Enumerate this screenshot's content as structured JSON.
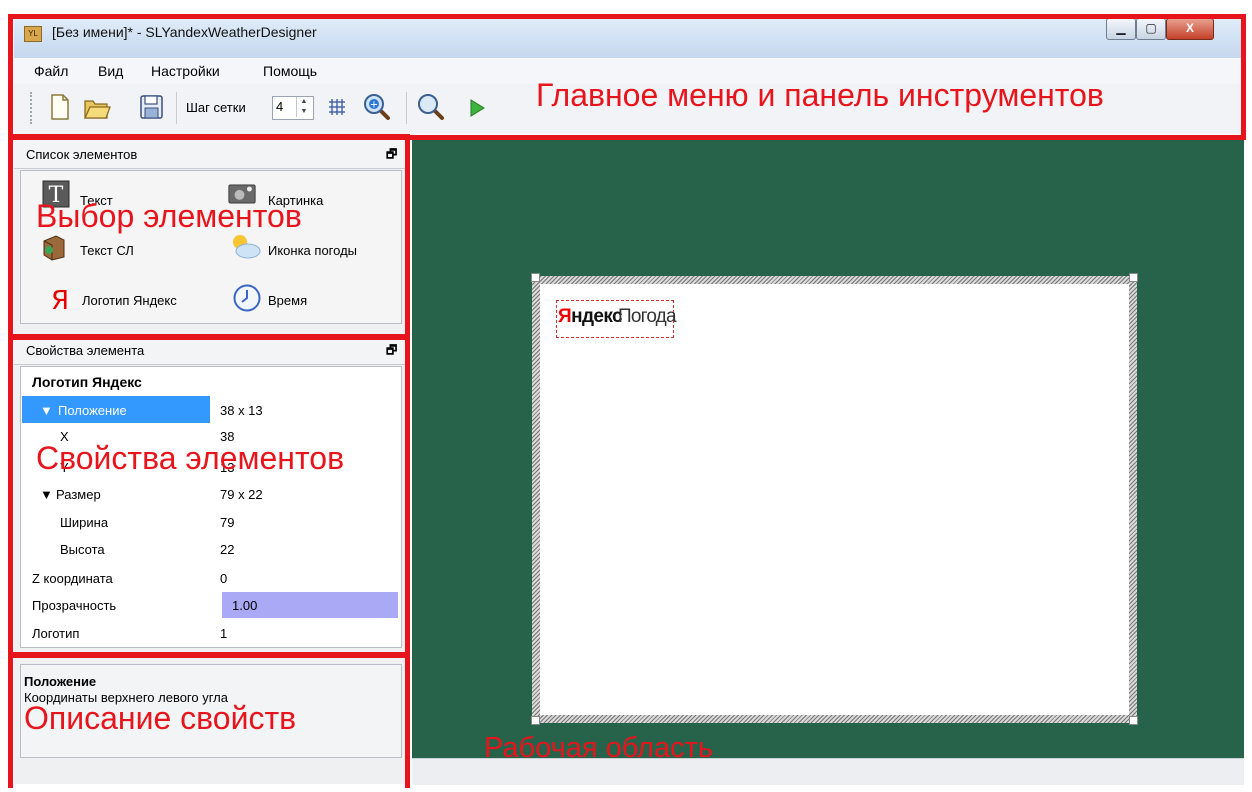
{
  "window": {
    "title": "[Без имени]* - SLYandexWeatherDesigner",
    "app_icon_text": "YL",
    "controls": {
      "minimize": "▁",
      "maximize": "▢",
      "close": "X"
    }
  },
  "menu": {
    "items": [
      "Файл",
      "Вид",
      "Настройки",
      "Помощь"
    ]
  },
  "toolbar": {
    "grid_step_label": "Шаг сетки",
    "grid_step_value": "4",
    "icons": [
      "new-file-icon",
      "open-folder-icon",
      "save-icon",
      "grid-icon",
      "zoom-in-icon",
      "zoom-out-icon",
      "play-icon"
    ]
  },
  "elements_panel": {
    "title": "Список элементов",
    "float_icon": "🗗",
    "items": [
      {
        "label": "Текст",
        "icon": "text-icon"
      },
      {
        "label": "Картинка",
        "icon": "picture-icon"
      },
      {
        "label": "Текст СЛ",
        "icon": "text-sl-icon"
      },
      {
        "label": "Иконка погоды",
        "icon": "weather-icon"
      },
      {
        "label": "Логотип Яндекс",
        "icon": "yandex-logo-icon"
      },
      {
        "label": "Время",
        "icon": "clock-icon"
      }
    ]
  },
  "properties_panel": {
    "title": "Свойства элемента",
    "float_icon": "🗗",
    "element_name": "Логотип Яндекс",
    "rows": [
      {
        "name": "Положение",
        "value": "38 x 13"
      },
      {
        "name": "X",
        "value": "38"
      },
      {
        "name": "Y",
        "value": "13"
      },
      {
        "name": "Размер",
        "value": "79 x 22"
      },
      {
        "name": "Ширина",
        "value": "79"
      },
      {
        "name": "Высота",
        "value": "22"
      },
      {
        "name": "Z координата",
        "value": "0"
      },
      {
        "name": "Прозрачность",
        "value": "1.00"
      },
      {
        "name": "Логотип",
        "value": "1"
      }
    ]
  },
  "description": {
    "title": "Положение",
    "text": "Координаты верхнего левого угла"
  },
  "canvas": {
    "logo_first_letter": "Я",
    "logo_rest": "ндекс",
    "logo_pogoda": "Погода"
  },
  "annotations": {
    "main_menu": "Главное меню и панель инструментов",
    "element_selection": "Выбор элементов",
    "element_properties": "Свойства элементов",
    "property_description": "Описание свойств",
    "work_area": "Рабочая область"
  },
  "colors": {
    "annotation": "#e8141c",
    "workspace": "#27624a",
    "selection": "#3399ff",
    "opacity_bar": "#a9a9f5"
  }
}
